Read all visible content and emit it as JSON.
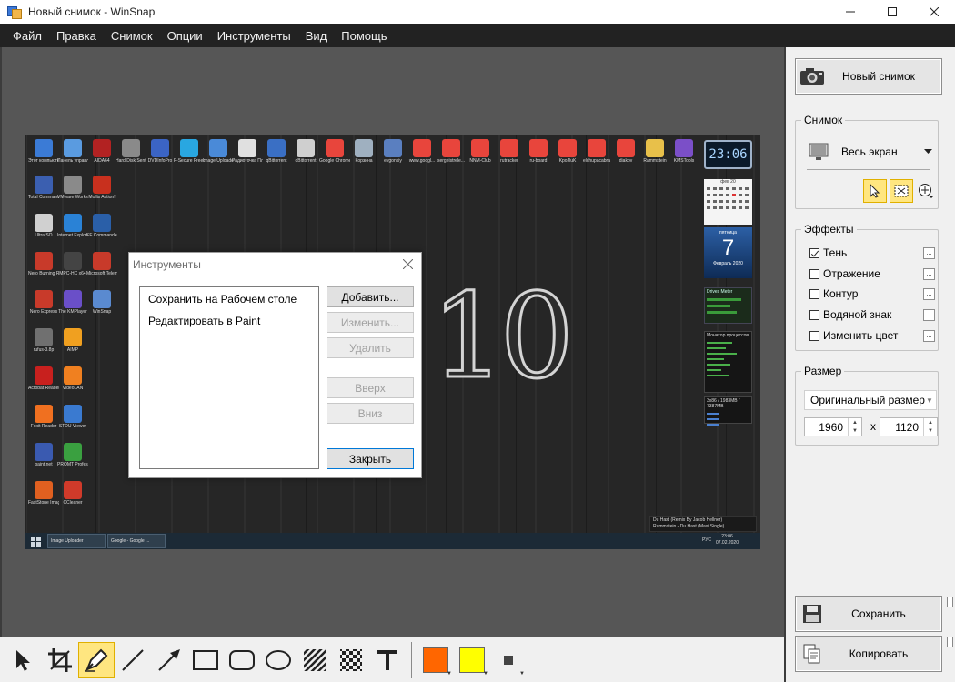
{
  "window": {
    "title": "Новый снимок - WinSnap"
  },
  "menu": [
    "Файл",
    "Правка",
    "Снимок",
    "Опции",
    "Инструменты",
    "Вид",
    "Помощь"
  ],
  "desktop": {
    "icons": [
      {
        "label": "Этот компьютер",
        "color": "#3b7bd6"
      },
      {
        "label": "Панель управления",
        "color": "#5a9be0"
      },
      {
        "label": "AIDA64",
        "color": "#b22222"
      },
      {
        "label": "Hard Disk Sentinel Pro",
        "color": "#8a8a8a"
      },
      {
        "label": "DVDInfoPro",
        "color": "#3b64c4"
      },
      {
        "label": "F-Secure Freedo...",
        "color": "#29a7e1"
      },
      {
        "label": "Image Uploader",
        "color": "#4a8ad8"
      },
      {
        "label": "Радиоточка Плюс",
        "color": "#e0e0e0"
      },
      {
        "label": "qBittorrent",
        "color": "#3a6fc4"
      },
      {
        "label": "qBittorrent",
        "color": "#cfcfcf"
      },
      {
        "label": "Google Chrome",
        "color": "#e8453c"
      },
      {
        "label": "Корзина",
        "color": "#9fb0c0"
      },
      {
        "label": "evgonkiy",
        "color": "#5a7fc0"
      },
      {
        "label": "www.googl...",
        "color": "#e8453c"
      },
      {
        "label": "sergeistrele...",
        "color": "#e8453c"
      },
      {
        "label": "NNM-Club",
        "color": "#e8453c"
      },
      {
        "label": "rutracker",
        "color": "#e8453c"
      },
      {
        "label": "ru-board",
        "color": "#e8453c"
      },
      {
        "label": "KpoJluK",
        "color": "#e8453c"
      },
      {
        "label": "elchupacabra",
        "color": "#e8453c"
      },
      {
        "label": "diakov",
        "color": "#e8453c"
      },
      {
        "label": "Rammstein",
        "color": "#e8c04a"
      },
      {
        "label": "KMSTools",
        "color": "#7b4fc8"
      },
      {
        "label": "Total Commander",
        "color": "#3b5fb0"
      },
      {
        "label": "VMware Workstatio...",
        "color": "#8a8a8a"
      },
      {
        "label": "Mollis Action!",
        "color": "#c8301e"
      },
      {
        "label": "UltraISO",
        "color": "#d0d0d0"
      },
      {
        "label": "Internet Explorer",
        "color": "#2a82d6"
      },
      {
        "label": "EF Commander",
        "color": "#2a5fa8"
      },
      {
        "label": "Nero Burning ROM",
        "color": "#c83a2a"
      },
      {
        "label": "MPC-HC x64",
        "color": "#444444"
      },
      {
        "label": "Microsoft Telemetry ...",
        "color": "#c83a2a"
      },
      {
        "label": "Nero Express",
        "color": "#c83a2a"
      },
      {
        "label": "The KMPlayer",
        "color": "#6a4fc8"
      },
      {
        "label": "WinSnap",
        "color": "#5a8ad0"
      },
      {
        "label": "rufus-3.8p",
        "color": "#707070"
      },
      {
        "label": "AIMP",
        "color": "#f0a020"
      },
      {
        "label": "Acrobat Reader DC",
        "color": "#c8201e"
      },
      {
        "label": "VideoLAN",
        "color": "#f08020"
      },
      {
        "label": "Foxit Reader",
        "color": "#f07020"
      },
      {
        "label": "STDU Viewer",
        "color": "#3a7ad0"
      },
      {
        "label": "paint.net",
        "color": "#3a5ab0"
      },
      {
        "label": "PROMT Professional",
        "color": "#3aa040"
      },
      {
        "label": "FastStone Image Viewer",
        "color": "#e06020"
      },
      {
        "label": "CCleaner",
        "color": "#d03a2a"
      }
    ],
    "widgets": {
      "clock": "23:06",
      "calendar_header": "фев 20",
      "date_top": "пятница",
      "date_day": "7",
      "date_bottom": "Февраль 2020",
      "drives_title": "Drives Meter",
      "process_title": "Монитор процессов",
      "cpu_line": "3x86 / 1983MB / 7387MB",
      "music_line1": "Du Hast (Remix By Jacob Hellner)",
      "music_line2": "Rammstein - Du Hast (Maxi Single)"
    },
    "taskbar": {
      "tasks": [
        "Image Uploader",
        "Google - Google ..."
      ],
      "lang": "РУС",
      "time": "23:06",
      "date": "07.02.2020"
    },
    "logo_text": "10"
  },
  "dialog": {
    "title": "Инструменты",
    "items": [
      "Сохранить на Рабочем столе",
      "Редактировать в Paint"
    ],
    "buttons": {
      "add": "Добавить...",
      "edit": "Изменить...",
      "delete": "Удалить",
      "up": "Вверх",
      "down": "Вниз",
      "close": "Закрыть"
    }
  },
  "panel": {
    "new_snapshot": "Новый снимок",
    "snapshot_group": "Снимок",
    "snapshot_mode": "Весь экран",
    "effects_group": "Эффекты",
    "effects": [
      {
        "label": "Тень",
        "checked": true
      },
      {
        "label": "Отражение",
        "checked": false
      },
      {
        "label": "Контур",
        "checked": false
      },
      {
        "label": "Водяной знак",
        "checked": false
      },
      {
        "label": "Изменить цвет",
        "checked": false
      }
    ],
    "size_group": "Размер",
    "size_mode": "Оригинальный размер",
    "width": "1960",
    "height": "1120",
    "x_sign": "x",
    "save": "Сохранить",
    "copy": "Копировать"
  },
  "toolbar": {
    "tools": [
      "pointer-icon",
      "crop-icon",
      "pen-icon",
      "line-icon",
      "arrow-icon",
      "rectangle-icon",
      "rounded-rectangle-icon",
      "ellipse-icon",
      "hatch-icon",
      "pixelate-icon",
      "text-icon"
    ],
    "active_tool": "pen-icon",
    "colors": {
      "primary": "#ff6600",
      "secondary": "#ffff00"
    }
  }
}
